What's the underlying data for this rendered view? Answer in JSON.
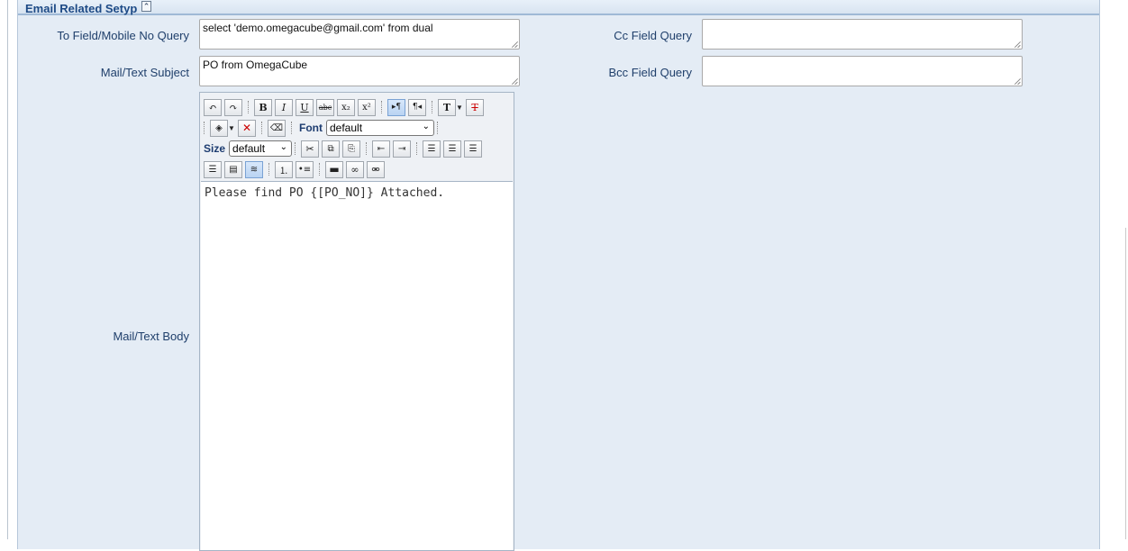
{
  "section": {
    "title": "Email Related Setyp",
    "collapse_glyph": "⌃"
  },
  "fields": {
    "to_label": "To Field/Mobile No Query",
    "to_value": "select  'demo.omegacube@gmail.com'  from dual",
    "cc_label": "Cc Field Query",
    "cc_value": "",
    "subject_label": "Mail/Text Subject",
    "subject_value": "PO from OmegaCube",
    "bcc_label": "Bcc Field Query",
    "bcc_value": "",
    "body_label": "Mail/Text Body"
  },
  "editor": {
    "font_label": "Font",
    "font_value": "default",
    "size_label": "Size",
    "size_value": "default",
    "body_text": "Please find PO {[PO_NO]} Attached."
  },
  "icons": [
    "undo-icon",
    "redo-icon",
    "bold-icon",
    "italic-icon",
    "underline-icon",
    "strikethrough-icon",
    "subscript-icon",
    "superscript-icon",
    "ltr-icon",
    "rtl-icon",
    "text-color-icon",
    "remove-format-icon",
    "highlight-color-icon",
    "remove-highlight-icon",
    "eraser-icon",
    "cut-icon",
    "copy-icon",
    "paste-icon",
    "outdent-icon",
    "indent-icon",
    "align-left-icon",
    "align-center-icon",
    "align-right-icon",
    "justify-icon",
    "source-icon",
    "ordered-list-icon",
    "unordered-list-icon",
    "horizontal-rule-icon",
    "link-icon",
    "unlink-icon"
  ],
  "colors": {
    "panel_bg": "#e4ecf5",
    "header_border": "#9fb9d6",
    "title": "#1d4a86",
    "label": "#1f3f6b"
  }
}
